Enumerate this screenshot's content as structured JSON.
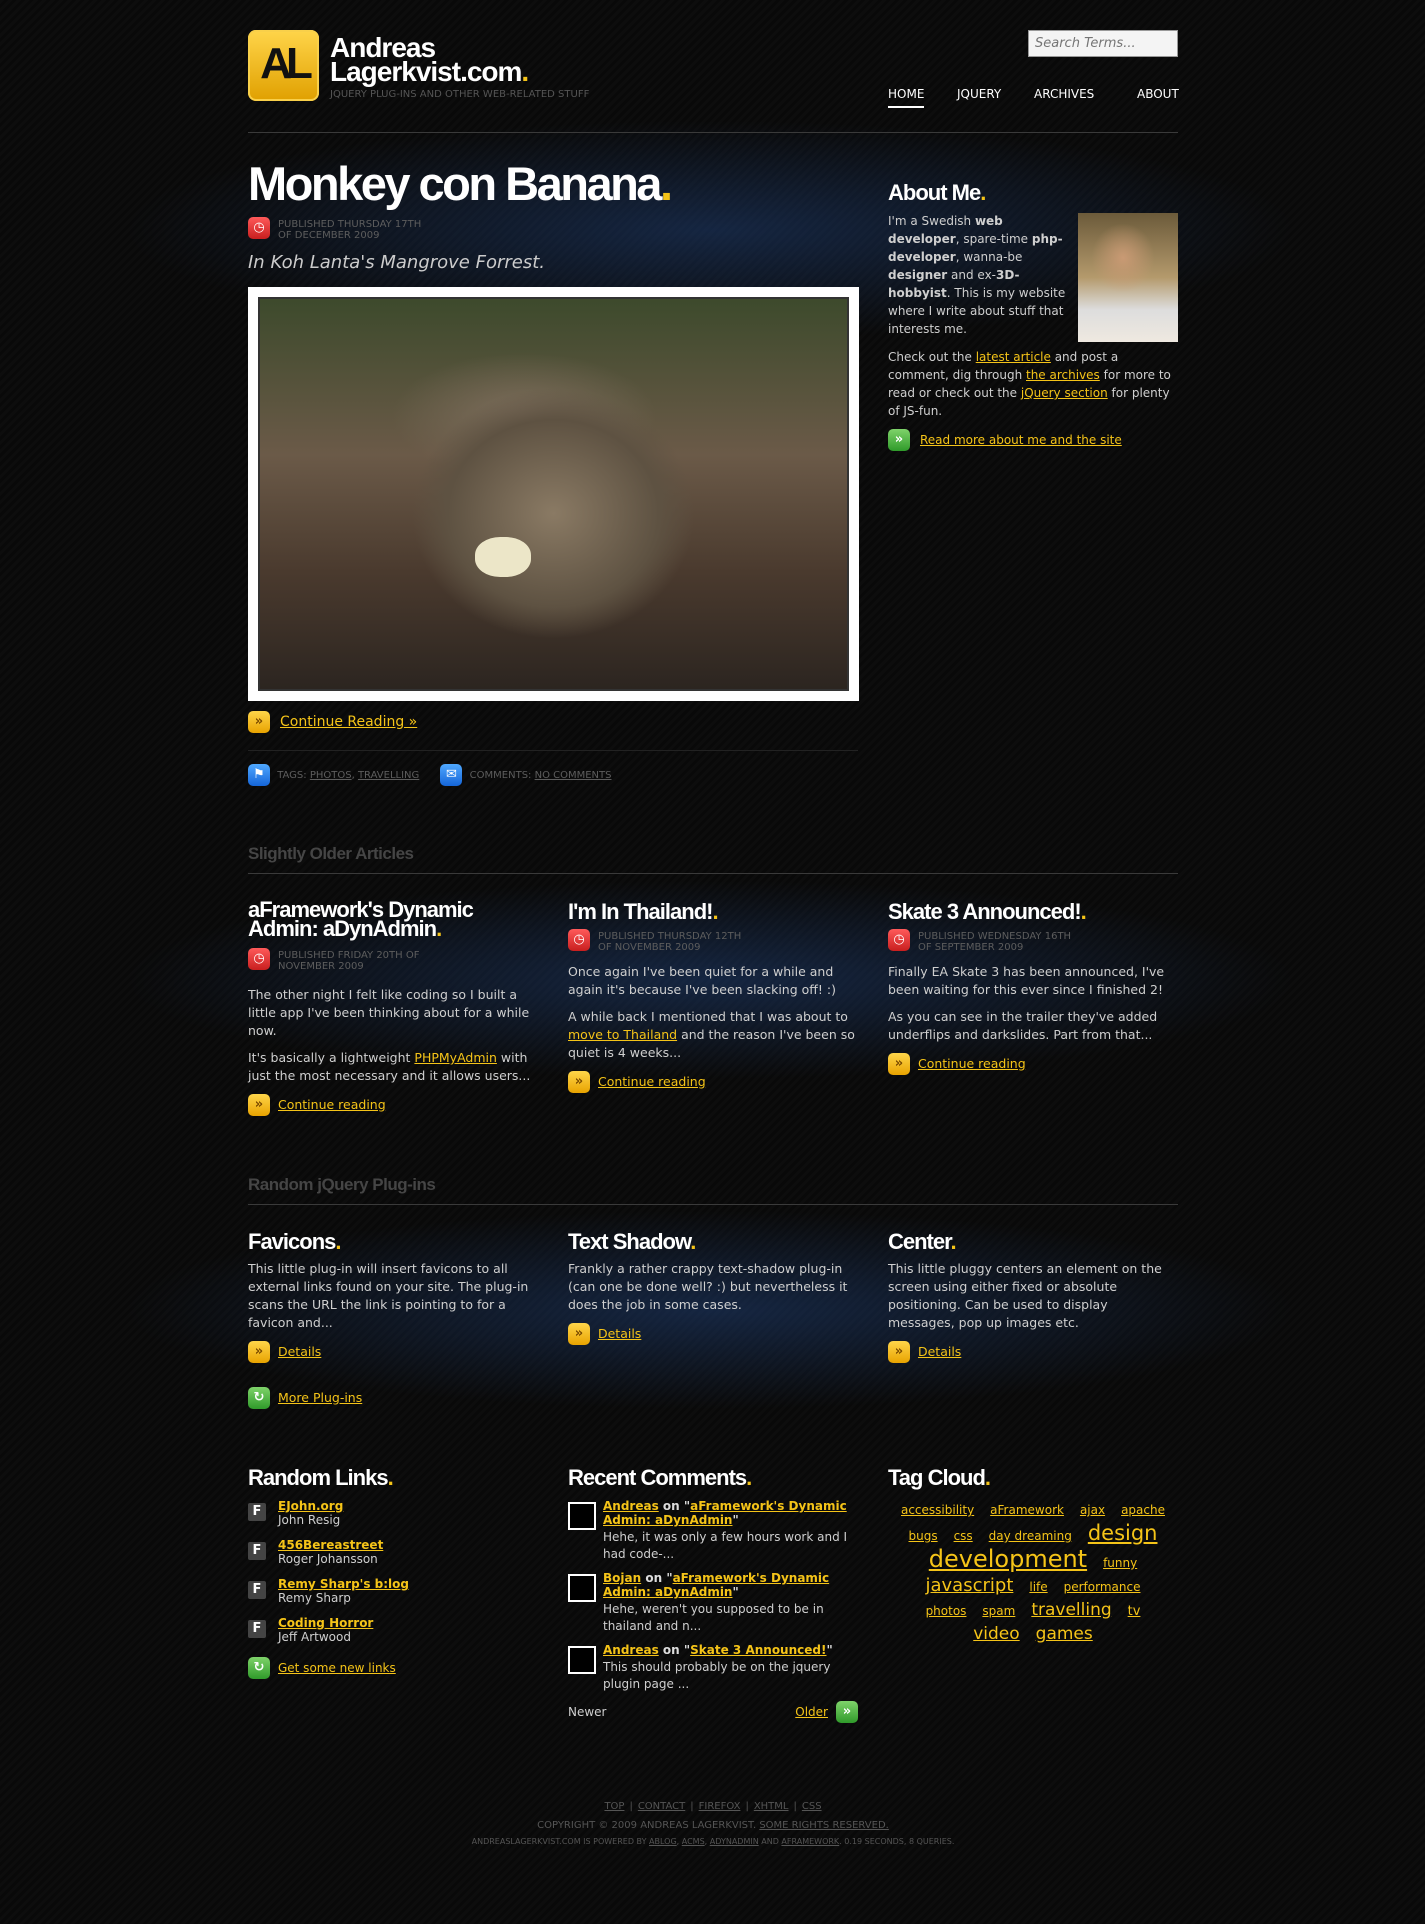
{
  "site": {
    "name_line1": "Andreas",
    "name_line2": "Lagerkvist.com",
    "dot": ".",
    "tagline": "jQuery Plug-ins and Other Web-Related Stuff",
    "logo_letters": "AL"
  },
  "search": {
    "placeholder": "Search Terms..."
  },
  "nav": [
    "Home",
    "jQuery",
    "Archives",
    "About"
  ],
  "post": {
    "title": "Monkey con Banana",
    "meta_line1": "Published Thursday 17th",
    "meta_line2": "of December 2009",
    "subtitle": "In Koh Lanta's Mangrove Forrest.",
    "continue": "Continue Reading »",
    "tags_label": "Tags:",
    "tag1": "Photos",
    "tag2": "Travelling",
    "comments_label": "Comments:",
    "comments_link": "No comments"
  },
  "about": {
    "title": "About Me",
    "p1": {
      "a": "I'm a Swedish ",
      "b": "web developer",
      "c": ", spare-time ",
      "d": "php-developer",
      "e": ", wanna-be ",
      "f": "designer",
      "g": " and ex-",
      "h": "3D-hobbyist",
      "i": ". This is my website where I write about stuff that interests me."
    },
    "p2": {
      "a": "Check out the ",
      "l1": "latest article",
      "b": " and post a comment, dig through ",
      "l2": "the archives",
      "c": " for more to read or check out the ",
      "l3": "jQuery section",
      "d": " for plenty of JS-fun."
    },
    "readmore": "Read more about me and the site"
  },
  "older": {
    "title": "Slightly Older Articles",
    "articles": [
      {
        "title": "aFramework's Dynamic Admin: aDynAdmin",
        "meta": "Published Friday 20th of November 2009",
        "p1": "The other night I felt like coding so I built a little app I've been thinking about for a while now.",
        "p2a": "It's basically a lightweight ",
        "p2l": "PHPMyAdmin",
        "p2b": " with just the most necessary and it allows users...",
        "link": "Continue reading"
      },
      {
        "title": "I'm In Thailand!",
        "meta": "Published Thursday 12th of November 2009",
        "p1": "Once again I've been quiet for a while and again it's because I've been slacking off! :)",
        "p2a": "A while back I mentioned that I was about to ",
        "p2l": "move to Thailand",
        "p2b": " and the reason I've been so quiet is 4 weeks...",
        "link": "Continue reading"
      },
      {
        "title": "Skate 3 Announced!",
        "meta": "Published Wednesday 16th of September 2009",
        "p1": "Finally EA Skate 3 has been announced, I've been waiting for this ever since I finished 2!",
        "p2a": "As you can see in the trailer they've added underflips and darkslides. Part from that...",
        "p2l": "",
        "p2b": "",
        "link": "Continue reading"
      }
    ]
  },
  "plugins": {
    "title": "Random jQuery Plug-ins",
    "items": [
      {
        "title": "Favicons",
        "text": "This little plug-in will insert favicons to all external links found on your site. The plug-in scans the URL the link is pointing to for a favicon and...",
        "link": "Details"
      },
      {
        "title": "Text Shadow",
        "text": "Frankly a rather crappy text-shadow plug-in (can one be done well? :) but nevertheless it does the job in some cases.",
        "link": "Details"
      },
      {
        "title": "Center",
        "text": "This little pluggy centers an element on the screen using either fixed or absolute positioning. Can be used to display messages, pop up images etc.",
        "link": "Details"
      }
    ],
    "more": "More Plug-ins"
  },
  "links": {
    "title": "Random Links",
    "items": [
      {
        "name": "EJohn.org",
        "by": "John Resig"
      },
      {
        "name": "456Bereastreet",
        "by": "Roger Johansson"
      },
      {
        "name": "Remy Sharp's b:log",
        "by": "Remy Sharp"
      },
      {
        "name": "Coding Horror",
        "by": "Jeff Artwood"
      }
    ],
    "more": "Get some new links"
  },
  "comments": {
    "title": "Recent Comments",
    "on": " on ",
    "items": [
      {
        "author": "Andreas",
        "post": "aFramework's Dynamic Admin: aDynAdmin",
        "text": "Hehe, it was only a few hours work and I had code-..."
      },
      {
        "author": "Bojan",
        "post": "aFramework's Dynamic Admin: aDynAdmin",
        "text": "Hehe, weren't you supposed to be in thailand and n..."
      },
      {
        "author": "Andreas",
        "post": "Skate 3 Announced!",
        "text": "This should probably be on the jquery plugin page ..."
      }
    ],
    "newer": "Newer",
    "older": "Older"
  },
  "tags": {
    "title": "Tag Cloud",
    "items": [
      "accessibility",
      "aFramework",
      "ajax",
      "apache",
      "bugs",
      "css",
      "day dreaming",
      "design",
      "development",
      "funny",
      "javascript",
      "life",
      "performance",
      "photos",
      "spam",
      "travelling",
      "tv",
      "video",
      "games"
    ]
  },
  "footer": {
    "links": [
      "Top",
      "Contact",
      "Firefox",
      "XHTML",
      "CSS"
    ],
    "sep": "|",
    "copyright": "Copyright © 2009 Andreas Lagerkvist.",
    "rights": "Some rights reserved.",
    "powered_a": "AndreasLagerkvist.com is powered by",
    "p1": "aBlog",
    "p2": "aCMS",
    "p3": "aDynAdmin",
    "and": "and",
    "p4": "aFramework",
    "stats": ". 0.19 seconds, 8 queries."
  },
  "colors": {
    "accent": "#f5c418",
    "bg": "#0b0b0b"
  }
}
